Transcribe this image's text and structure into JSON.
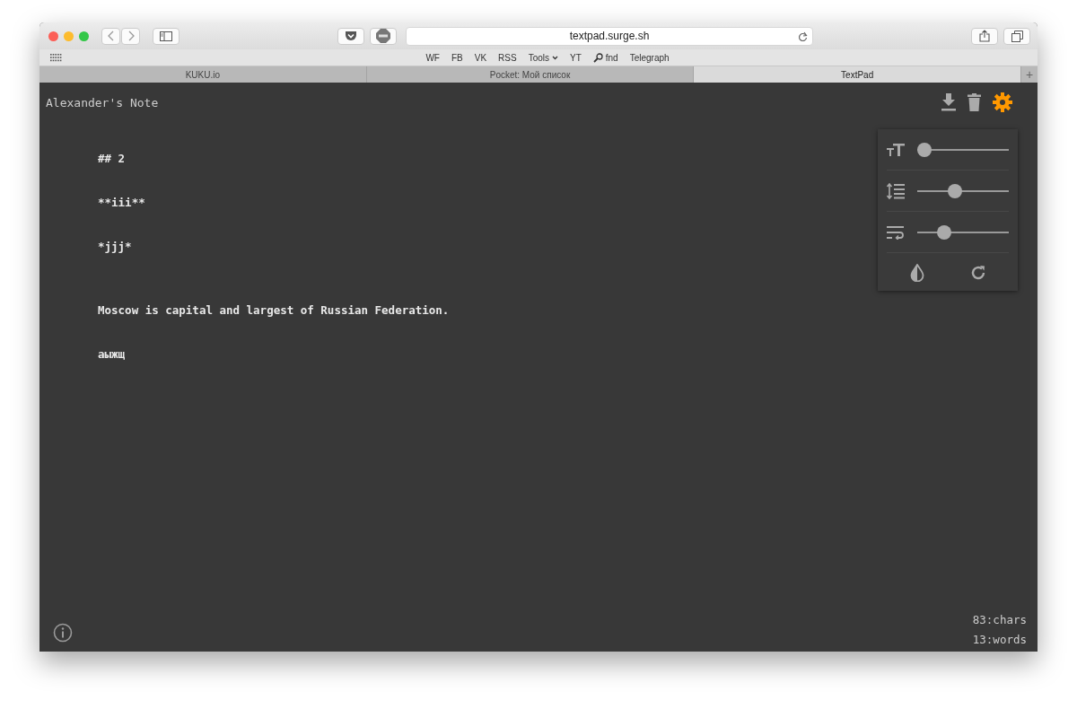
{
  "browser": {
    "url": "textpad.surge.sh",
    "bookmarks": [
      {
        "label": "WF",
        "kind": "link"
      },
      {
        "label": "FB",
        "kind": "link"
      },
      {
        "label": "VK",
        "kind": "link"
      },
      {
        "label": "RSS",
        "kind": "link"
      },
      {
        "label": "Tools",
        "kind": "menu"
      },
      {
        "label": "YT",
        "kind": "link"
      },
      {
        "label": "fnd",
        "kind": "search"
      },
      {
        "label": "Telegraph",
        "kind": "link"
      }
    ],
    "tabs": [
      {
        "label": "KUKU.io",
        "selected": false
      },
      {
        "label": "Pocket: Мой список",
        "selected": false
      },
      {
        "label": "TextPad",
        "selected": true
      }
    ],
    "new_tab": "+"
  },
  "app": {
    "title": "Alexander's Note",
    "lines": [
      "## 2",
      "**iii**",
      "*jjj*",
      "Moscow is capital and largest of Russian Federation.",
      "аыжщ"
    ],
    "settings_open": true,
    "sliders": [
      {
        "kind": "font-size",
        "level": 0.0
      },
      {
        "kind": "line-height",
        "level": 0.4
      },
      {
        "kind": "wrap",
        "level": 0.25
      }
    ],
    "stats": [
      "83:chars",
      "13:words"
    ]
  }
}
